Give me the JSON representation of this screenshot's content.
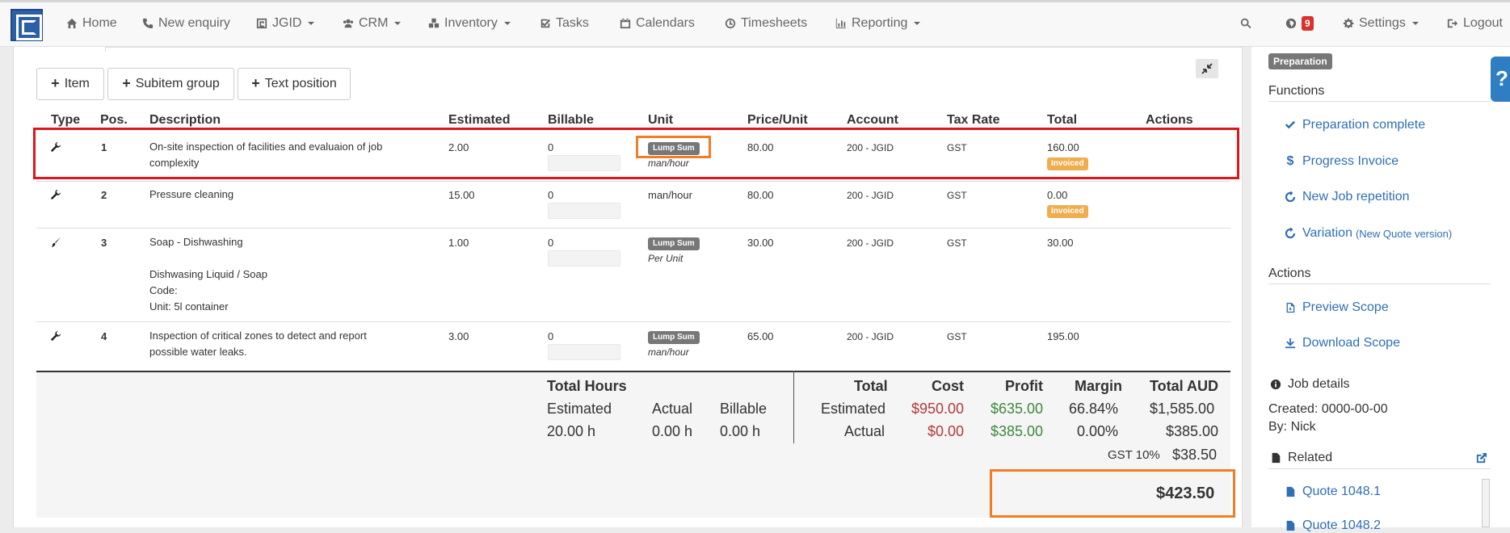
{
  "nav": {
    "home": "Home",
    "new_enquiry": "New enquiry",
    "jgid": "JGID",
    "crm": "CRM",
    "inventory": "Inventory",
    "tasks": "Tasks",
    "calendars": "Calendars",
    "timesheets": "Timesheets",
    "reporting": "Reporting",
    "notifications_count": "9",
    "settings": "Settings",
    "logout": "Logout"
  },
  "toolbar": {
    "item": "Item",
    "subitem_group": "Subitem group",
    "text_position": "Text position"
  },
  "table": {
    "headers": [
      "Type",
      "Pos.",
      "Description",
      "Estimated",
      "Billable",
      "Unit",
      "Price/Unit",
      "Account",
      "Tax Rate",
      "Total",
      "Actions"
    ],
    "rows": [
      {
        "pos": "1",
        "desc1": "On-site inspection of facilities and evaluaion of job",
        "desc2": "complexity",
        "estimated": "2.00",
        "billable": "0",
        "lump": "Lump Sum",
        "unit": "man/hour",
        "price": "80.00",
        "account": "200 - JGID",
        "tax": "GST",
        "total": "160.00",
        "status": "Invoiced"
      },
      {
        "pos": "2",
        "desc1": "Pressure cleaning",
        "estimated": "15.00",
        "billable": "0",
        "unit": "man/hour",
        "price": "80.00",
        "account": "200 - JGID",
        "tax": "GST",
        "total": "0.00",
        "status": "Invoiced"
      },
      {
        "pos": "3",
        "desc1": "Soap - Dishwashing",
        "desc2": "Dishwasing Liquid / Soap",
        "desc3": "Code:",
        "desc4": "Unit: 5l container",
        "estimated": "1.00",
        "billable": "0",
        "lump": "Lump Sum",
        "unit": "Per Unit",
        "price": "30.00",
        "account": "200 - JGID",
        "tax": "GST",
        "total": "30.00"
      },
      {
        "pos": "4",
        "desc1": "Inspection of critical zones to detect and report",
        "desc2": "possible water leaks.",
        "estimated": "3.00",
        "billable": "0",
        "lump": "Lump Sum",
        "unit": "man/hour",
        "price": "65.00",
        "account": "200 - JGID",
        "tax": "GST",
        "total": "195.00"
      }
    ]
  },
  "summary": {
    "total_hours_label": "Total Hours",
    "estimated_label": "Estimated",
    "actual_label": "Actual",
    "billable_label": "Billable",
    "est_hours": "20.00 h",
    "actual_hours": "0.00 h",
    "billable_hours": "0.00 h",
    "total_label": "Total",
    "cost_label": "Cost",
    "profit_label": "Profit",
    "margin_label": "Margin",
    "total_aud_label": "Total AUD",
    "est_row_label": "Estimated",
    "act_row_label": "Actual",
    "est_cost": "$950.00",
    "est_profit": "$635.00",
    "est_margin": "66.84%",
    "est_total": "$1,585.00",
    "act_cost": "$0.00",
    "act_profit": "$385.00",
    "act_margin": "0.00%",
    "act_total": "$385.00",
    "gst_label": "GST 10%",
    "gst_value": "$38.50",
    "grand_total": "$423.50"
  },
  "sidebar": {
    "status": "Preparation",
    "functions_heading": "Functions",
    "preparation_complete": "Preparation complete",
    "progress_invoice": "Progress Invoice",
    "new_job_repetition": "New Job repetition",
    "variation": "Variation",
    "variation_note": "(New Quote version)",
    "actions_heading": "Actions",
    "preview_scope": "Preview Scope",
    "download_scope": "Download Scope",
    "job_details_heading": "Job details",
    "created": "Created: 0000-00-00",
    "by": "By: Nick",
    "related_heading": "Related",
    "quote1": "Quote 1048.1",
    "quote2": "Quote 1048.2"
  }
}
